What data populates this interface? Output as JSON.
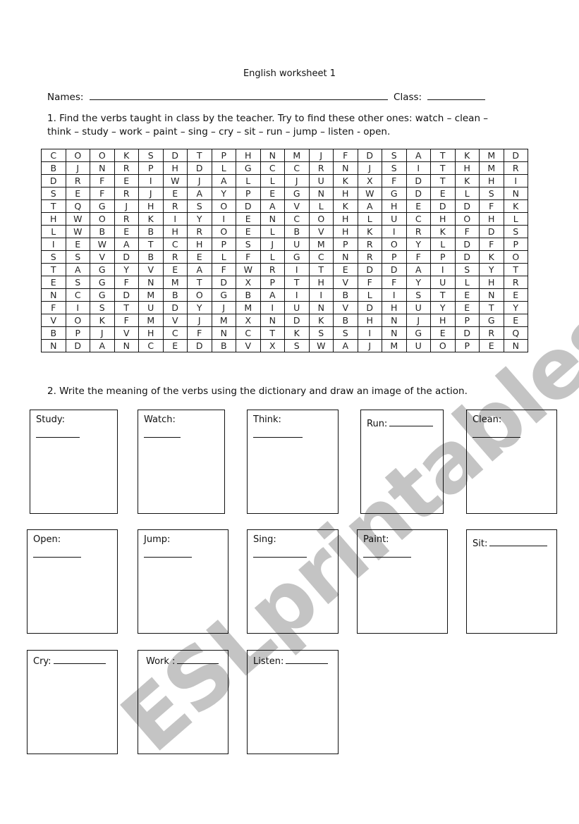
{
  "title": "English worksheet 1",
  "names_label": "Names:",
  "class_label": "Class:",
  "instruction_1": {
    "line1": "1. Find the verbs taught in class by the teacher. Try to find these other ones:  watch – clean –",
    "line2": "think – study –  work – paint – sing – cry – sit – run – jump – listen - open."
  },
  "word_search": [
    [
      "C",
      "O",
      "O",
      "K",
      "S",
      "D",
      "T",
      "P",
      "H",
      "N",
      "M",
      "J",
      "F",
      "D",
      "S",
      "A",
      "T",
      "K",
      "M",
      "D"
    ],
    [
      "B",
      "J",
      "N",
      "R",
      "P",
      "H",
      "D",
      "L",
      "G",
      "C",
      "C",
      "R",
      "N",
      "J",
      "S",
      "I",
      "T",
      "H",
      "M",
      "R"
    ],
    [
      "D",
      "R",
      "F",
      "E",
      "I",
      "W",
      "J",
      "A",
      "L",
      "L",
      "J",
      "U",
      "K",
      "X",
      "F",
      "D",
      "T",
      "K",
      "H",
      "I"
    ],
    [
      "S",
      "E",
      "F",
      "R",
      "J",
      "E",
      "A",
      "Y",
      "P",
      "E",
      "G",
      "N",
      "H",
      "W",
      "G",
      "D",
      "E",
      "L",
      "S",
      "N"
    ],
    [
      "T",
      "Q",
      "G",
      "J",
      "H",
      "R",
      "S",
      "O",
      "D",
      "A",
      "V",
      "L",
      "K",
      "A",
      "H",
      "E",
      "D",
      "D",
      "F",
      "K"
    ],
    [
      "H",
      "W",
      "O",
      "R",
      "K",
      "I",
      "Y",
      "I",
      "E",
      "N",
      "C",
      "O",
      "H",
      "L",
      "U",
      "C",
      "H",
      "O",
      "H",
      "L"
    ],
    [
      "L",
      "W",
      "B",
      "E",
      "B",
      "H",
      "R",
      "O",
      "E",
      "L",
      "B",
      "V",
      "H",
      "K",
      "I",
      "R",
      "K",
      "F",
      "D",
      "S"
    ],
    [
      "I",
      "E",
      "W",
      "A",
      "T",
      "C",
      "H",
      "P",
      "S",
      "J",
      "U",
      "M",
      "P",
      "R",
      "O",
      "Y",
      "L",
      "D",
      "F",
      "P"
    ],
    [
      "S",
      "S",
      "V",
      "D",
      "B",
      "R",
      "E",
      "L",
      "F",
      "L",
      "G",
      "C",
      "N",
      "R",
      "P",
      "F",
      "P",
      "D",
      "K",
      "O"
    ],
    [
      "T",
      "A",
      "G",
      "Y",
      "V",
      "E",
      "A",
      "F",
      "W",
      "R",
      "I",
      "T",
      "E",
      "D",
      "D",
      "A",
      "I",
      "S",
      "Y",
      "T"
    ],
    [
      "E",
      "S",
      "G",
      "F",
      "N",
      "M",
      "T",
      "D",
      "X",
      "P",
      "T",
      "H",
      "V",
      "F",
      "F",
      "Y",
      "U",
      "L",
      "H",
      "R"
    ],
    [
      "N",
      "C",
      "G",
      "D",
      "M",
      "B",
      "O",
      "G",
      "B",
      "A",
      "I",
      "I",
      "B",
      "L",
      "I",
      "S",
      "T",
      "E",
      "N",
      "E"
    ],
    [
      "F",
      "I",
      "S",
      "T",
      "U",
      "D",
      "Y",
      "J",
      "M",
      "I",
      "U",
      "N",
      "V",
      "D",
      "H",
      "U",
      "Y",
      "E",
      "T",
      "Y"
    ],
    [
      "V",
      "O",
      "K",
      "F",
      "M",
      "V",
      "J",
      "M",
      "X",
      "N",
      "D",
      "K",
      "B",
      "H",
      "N",
      "J",
      "H",
      "P",
      "G",
      "E"
    ],
    [
      "B",
      "P",
      "J",
      "V",
      "H",
      "C",
      "F",
      "N",
      "C",
      "T",
      "K",
      "S",
      "S",
      "I",
      "N",
      "G",
      "E",
      "D",
      "R",
      "Q"
    ],
    [
      "N",
      "D",
      "A",
      "N",
      "C",
      "E",
      "D",
      "B",
      "V",
      "X",
      "S",
      "W",
      "A",
      "J",
      "M",
      "U",
      "O",
      "P",
      "E",
      "N"
    ]
  ],
  "instruction_2": "2. Write the meaning of the verbs using the dictionary and draw an image of the action.",
  "boxes": [
    {
      "label": "Study:"
    },
    {
      "label": "Watch:"
    },
    {
      "label": "Think:"
    },
    {
      "label": "Run:"
    },
    {
      "label": "Clean:"
    },
    {
      "label": "Open:"
    },
    {
      "label": "Jump:"
    },
    {
      "label": "Sing:"
    },
    {
      "label": "Paint:"
    },
    {
      "label": "Sit:"
    },
    {
      "label": "Cry:"
    },
    {
      "label": "Work :"
    },
    {
      "label": "Listen:"
    }
  ],
  "watermark": "ESLprintables.com"
}
